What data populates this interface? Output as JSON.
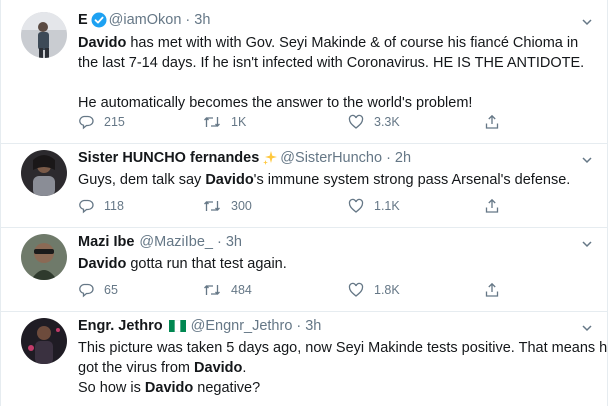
{
  "tweets": [
    {
      "name": "E",
      "verified": true,
      "handle": "@iamOkon",
      "sep": "·",
      "time": "3h",
      "body_bold": "Davido",
      "body_rest": " has met with with Gov. Seyi Makinde & of course his fiancé Chioma in the last 7-14 days. If he isn't infected with Coronavirus. HE IS THE ANTIDOTE.",
      "body_para2": "He automatically becomes the answer to the world's problem!",
      "replies": "215",
      "retweets": "1K",
      "likes": "3.3K"
    },
    {
      "name": "Sister HUNCHO fernandes",
      "emoji": "sparkles",
      "handle": "@SisterHuncho",
      "sep": "·",
      "time": "2h",
      "body_pre": "Guys, dem talk say ",
      "body_bold": "Davido",
      "body_rest": "'s immune system strong pass Arsenal's defense.",
      "replies": "118",
      "retweets": "300",
      "likes": "1.1K"
    },
    {
      "name": "Mazi Ibe",
      "handle": "@MaziIbe_",
      "sep": "·",
      "time": "3h",
      "body_bold": "Davido",
      "body_rest": " gotta run that test again.",
      "replies": "65",
      "retweets": "484",
      "likes": "1.8K"
    },
    {
      "name": "Engr. Jethro",
      "emoji": "nigeria-flag",
      "handle": "@Engnr_Jethro",
      "sep": "·",
      "time": "3h",
      "body_l1": "This picture was taken 5 days ago, now Seyi Makinde tests positive. That means he",
      "body_l2_pre": "got the virus from ",
      "body_l2_bold": "Davido",
      "body_l2_post": ".",
      "body_l3_pre": "So how is ",
      "body_l3_bold": "Davido",
      "body_l3_post": " negative?"
    }
  ],
  "colors": {
    "text": "#14171a",
    "muted": "#657786",
    "verified": "#1da1f2",
    "divider": "#e6ecf0"
  }
}
